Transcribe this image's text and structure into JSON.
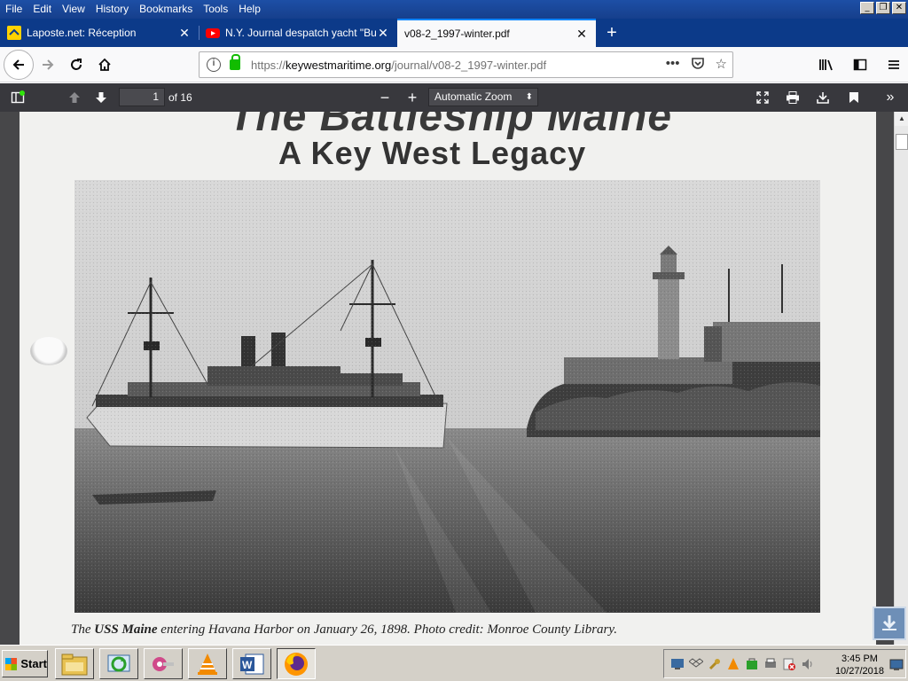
{
  "menubar": {
    "items": [
      "File",
      "Edit",
      "View",
      "History",
      "Bookmarks",
      "Tools",
      "Help"
    ]
  },
  "tabs": [
    {
      "title": "Laposte.net: Réception",
      "icon": "laposte-favicon"
    },
    {
      "title": "N.Y. Journal despatch yacht \"Bucc",
      "icon": "youtube-favicon"
    },
    {
      "title": "v08-2_1997-winter.pdf",
      "icon": "none"
    }
  ],
  "nav": {
    "url_prefix": "https://",
    "url_domain": "keywestmaritime.org",
    "url_path": "/journal/v08-2_1997-winter.pdf",
    "page_actions_label": "•••"
  },
  "pdf": {
    "page_current": "1",
    "page_count_label": "of 16",
    "zoom": "Automatic Zoom"
  },
  "document": {
    "title_line1": "The Battleship Maine",
    "title_line2": "A Key West Legacy",
    "caption_pre": "The ",
    "caption_bold": "USS Maine",
    "caption_post": " entering Havana Harbor on January 26, 1898. Photo credit: Monroe County Library."
  },
  "taskbar": {
    "start_label": "Start",
    "apps": [
      "file-explorer-icon",
      "sync-icon",
      "keys-icon",
      "vlc-icon",
      "word-icon",
      "firefox-icon"
    ],
    "clock_time": "3:45 PM",
    "clock_date": "10/27/2018"
  },
  "colors": {
    "menubar": "#163f8c",
    "tabstrip": "#0c3a89",
    "pdf_toolbar": "#38383d",
    "viewer_bg": "#474749",
    "accent": "#0a84ff"
  }
}
